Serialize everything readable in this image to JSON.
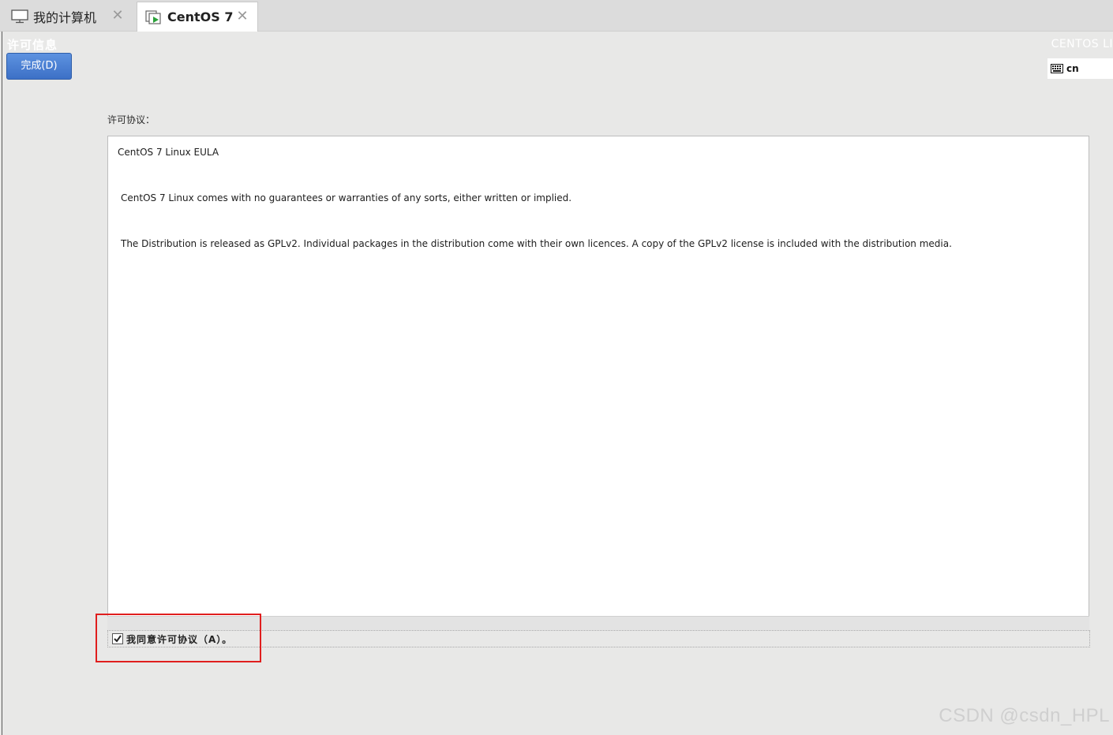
{
  "tabs": [
    {
      "label": "我的计算机",
      "icon": "monitor-icon",
      "active": false
    },
    {
      "label": "CentOS 7",
      "icon": "vm-icon",
      "active": true
    }
  ],
  "header": {
    "title": "许可信息",
    "done_button": "完成(D)",
    "brand": "CENTOS LI",
    "keyboard_layout": "cn"
  },
  "license": {
    "label": "许可协议：",
    "title": "CentOS 7 Linux EULA",
    "paragraphs": [
      "CentOS 7 Linux comes with no guarantees or warranties of any sorts, either written or implied.",
      "The Distribution is released as GPLv2. Individual packages in the distribution come with their own licences. A copy of the GPLv2 license is included with the distribution media."
    ],
    "agree_label": "我同意许可协议（A）。",
    "agreed": true
  },
  "watermark": "CSDN @csdn_HPL",
  "colors": {
    "done_button": "#3d70c6",
    "highlight": "#e01e1e",
    "background": "#e8e8e7"
  }
}
